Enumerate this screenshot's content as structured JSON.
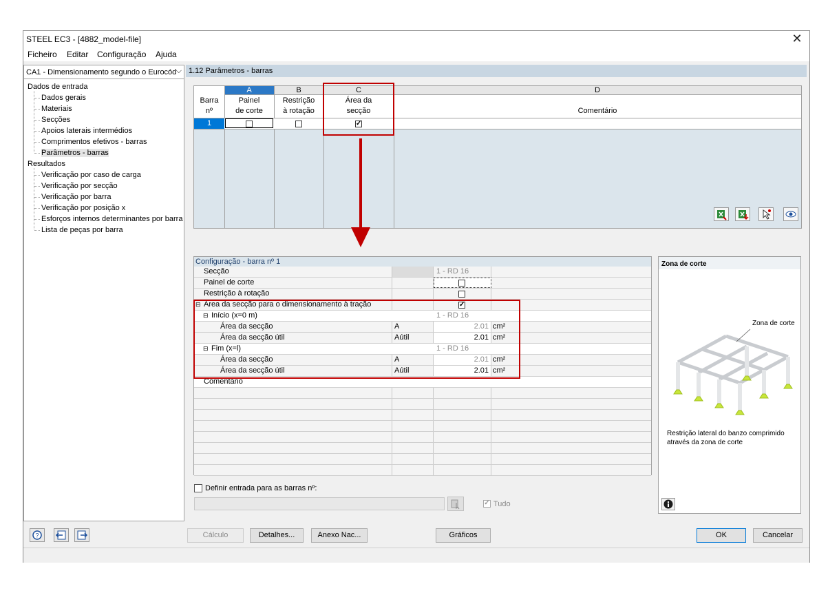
{
  "window": {
    "title": "STEEL EC3 - [4882_model-file]"
  },
  "menu": [
    "Ficheiro",
    "Editar",
    "Configuração",
    "Ajuda"
  ],
  "case_combo": {
    "value": "CA1 - Dimensionamento segundo o Eurocód"
  },
  "tree": {
    "input_group": "Dados de entrada",
    "input_items": [
      "Dados gerais",
      "Materiais",
      "Secções",
      "Apoios laterais intermédios",
      "Comprimentos efetivos - barras",
      "Parâmetros - barras"
    ],
    "results_group": "Resultados",
    "result_items": [
      "Verificação por caso de carga",
      "Verificação por secção",
      "Verificação por barra",
      "Verificação por posição x",
      "Esforços internos determinantes por barra",
      "Lista de peças por barra"
    ]
  },
  "section_title": "1.12 Parâmetros - barras",
  "grid": {
    "col_letters": [
      "A",
      "B",
      "C",
      "D"
    ],
    "row_header_1": "Barra",
    "row_header_2": "nº",
    "headers": {
      "a1": "Painel",
      "a2": "de corte",
      "b1": "Restrição",
      "b2": "à rotação",
      "c1": "Área da",
      "c2": "secção",
      "d": "Comentário"
    },
    "row1": {
      "barra": "1",
      "a": false,
      "b": false,
      "c": true,
      "comment": ""
    }
  },
  "config": {
    "title": "Configuração - barra nº 1",
    "rows": {
      "seccao": {
        "label": "Secção",
        "value": "1 - RD 16"
      },
      "painel": {
        "label": "Painel de corte"
      },
      "restricao": {
        "label": "Restrição à rotação"
      },
      "area_tracao": {
        "label": "Área da secção para o dimensionamento à tração"
      },
      "inicio": {
        "label": "Início (x=0 m)",
        "value": "1 - RD 16"
      },
      "inicio_area": {
        "label": "Área da secção",
        "symbol": "A",
        "value": "2.01",
        "unit": "cm²"
      },
      "inicio_util": {
        "label": "Área da secção útil",
        "symbol": "Aútil",
        "value": "2.01",
        "unit": "cm²"
      },
      "fim": {
        "label": "Fim (x=l)",
        "value": "1 - RD 16"
      },
      "fim_area": {
        "label": "Área da secção",
        "symbol": "A",
        "value": "2.01",
        "unit": "cm²"
      },
      "fim_util": {
        "label": "Área da secção útil",
        "symbol": "Aútil",
        "value": "2.01",
        "unit": "cm²"
      },
      "comentario": {
        "label": "Comentário"
      }
    },
    "define_label": "Definir entrada para as barras nº:",
    "tudo_label": "Tudo"
  },
  "image_panel": {
    "title": "Zona de corte",
    "callout": "Zona de corte",
    "caption1": "Restrição lateral do banzo comprimido",
    "caption2": "através da zona de corte"
  },
  "buttons": {
    "calculo": "Cálculo",
    "detalhes": "Detalhes...",
    "anexo": "Anexo Nac...",
    "graficos": "Gráficos",
    "ok": "OK",
    "cancelar": "Cancelar"
  },
  "colors": {
    "highlight_red": "#c00000",
    "grid_bg": "#dbe5ec",
    "selection_blue": "#0078d7",
    "support_green": "#c8e63a"
  }
}
